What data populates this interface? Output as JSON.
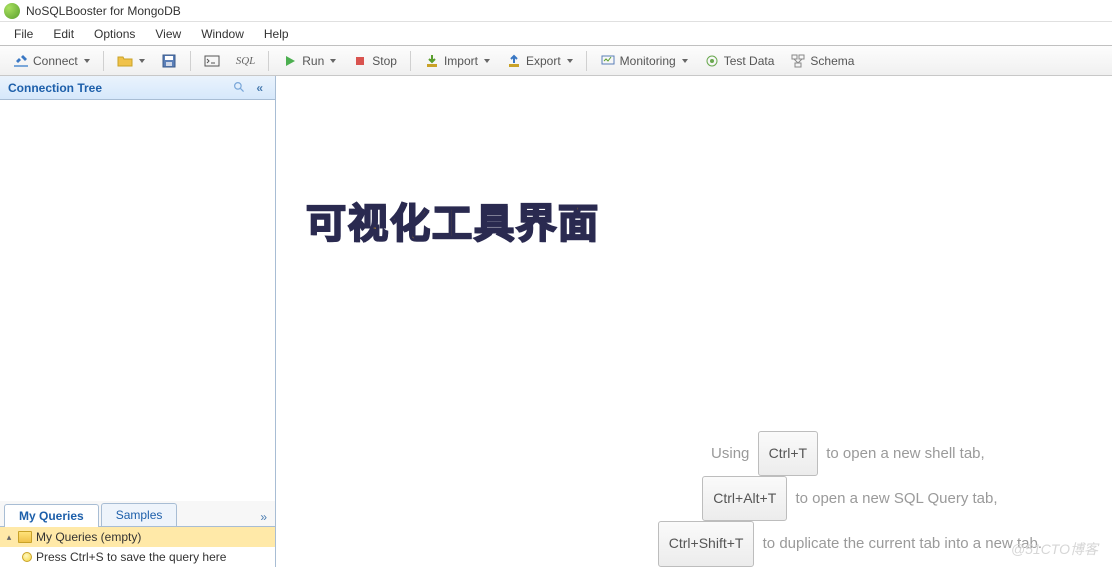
{
  "window": {
    "title": "NoSQLBooster for MongoDB"
  },
  "menu": {
    "items": [
      "File",
      "Edit",
      "Options",
      "View",
      "Window",
      "Help"
    ]
  },
  "toolbar": {
    "connect": "Connect",
    "sql": "SQL",
    "run": "Run",
    "stop": "Stop",
    "import": "Import",
    "export": "Export",
    "monitoring": "Monitoring",
    "testdata": "Test Data",
    "schema": "Schema"
  },
  "sidebar": {
    "header": "Connection Tree",
    "tabs": {
      "myqueries": "My Queries",
      "samples": "Samples"
    },
    "myqueries_root": "My Queries (empty)",
    "myqueries_hint": "Press Ctrl+S to save the query here"
  },
  "overlay": {
    "title": "可视化工具界面"
  },
  "hints": {
    "line1_pre": "Using",
    "line1_kbd": "Ctrl+T",
    "line1_post": "to open a new shell tab,",
    "line2_kbd": "Ctrl+Alt+T",
    "line2_post": "to open a new SQL Query tab,",
    "line3_kbd": "Ctrl+Shift+T",
    "line3_post": "to duplicate the current tab into a new tab."
  },
  "watermark": "@51CTO博客"
}
